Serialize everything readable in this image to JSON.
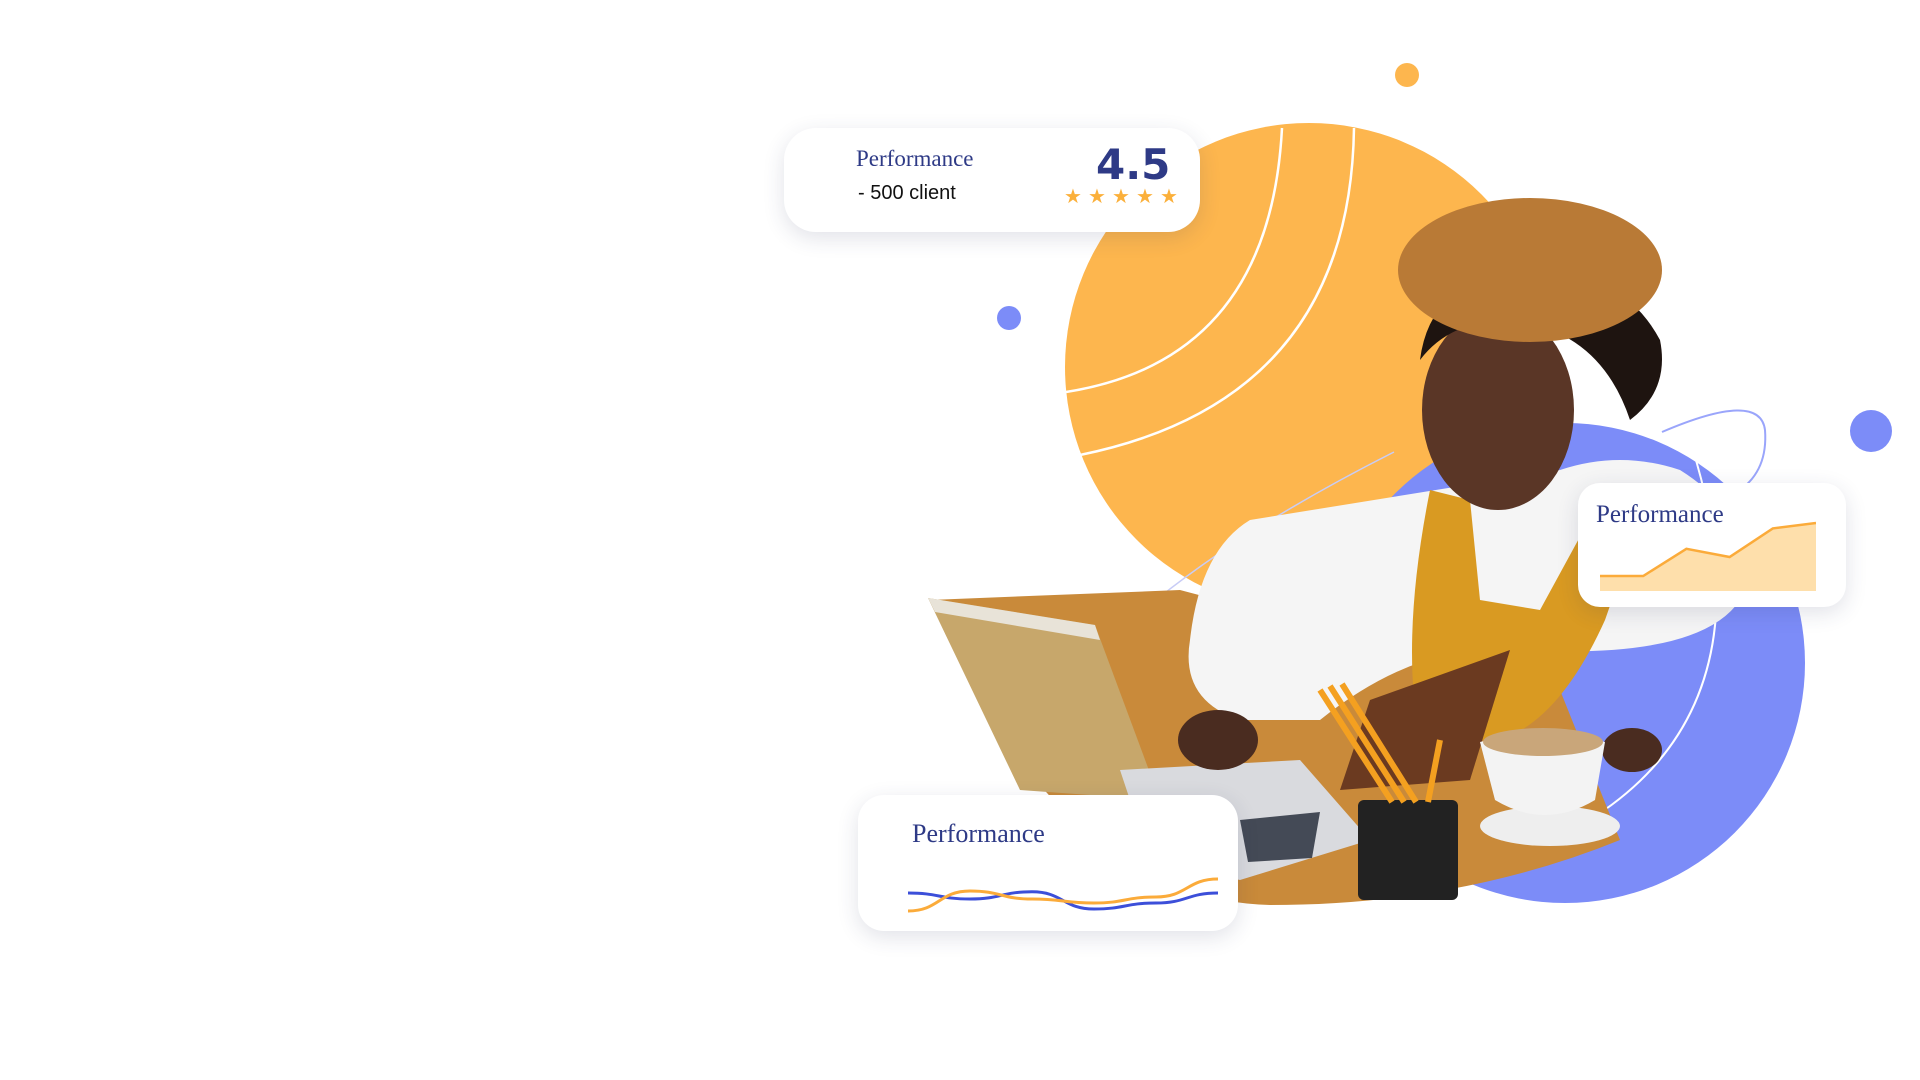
{
  "rating_card": {
    "title": "Performance",
    "subtitle": "- 500 client",
    "score": "4.5",
    "stars": 5
  },
  "area_card": {
    "title": "Performance",
    "chart_data": {
      "type": "area",
      "values": [
        0.22,
        0.22,
        0.62,
        0.5,
        0.92,
        1.0
      ]
    }
  },
  "line_card": {
    "title": "Performance",
    "chart_data": {
      "type": "line",
      "series": [
        {
          "values": [
            0.55,
            0.4,
            0.58,
            0.15,
            0.3,
            0.55
          ]
        },
        {
          "values": [
            0.1,
            0.6,
            0.4,
            0.3,
            0.45,
            0.9
          ]
        }
      ]
    }
  },
  "colors": {
    "orange": "#fdb64e",
    "blue": "#7c8cf8",
    "navy": "#2e3a86",
    "area_fill": "#fedfab",
    "area_line": "#fbab3a"
  }
}
